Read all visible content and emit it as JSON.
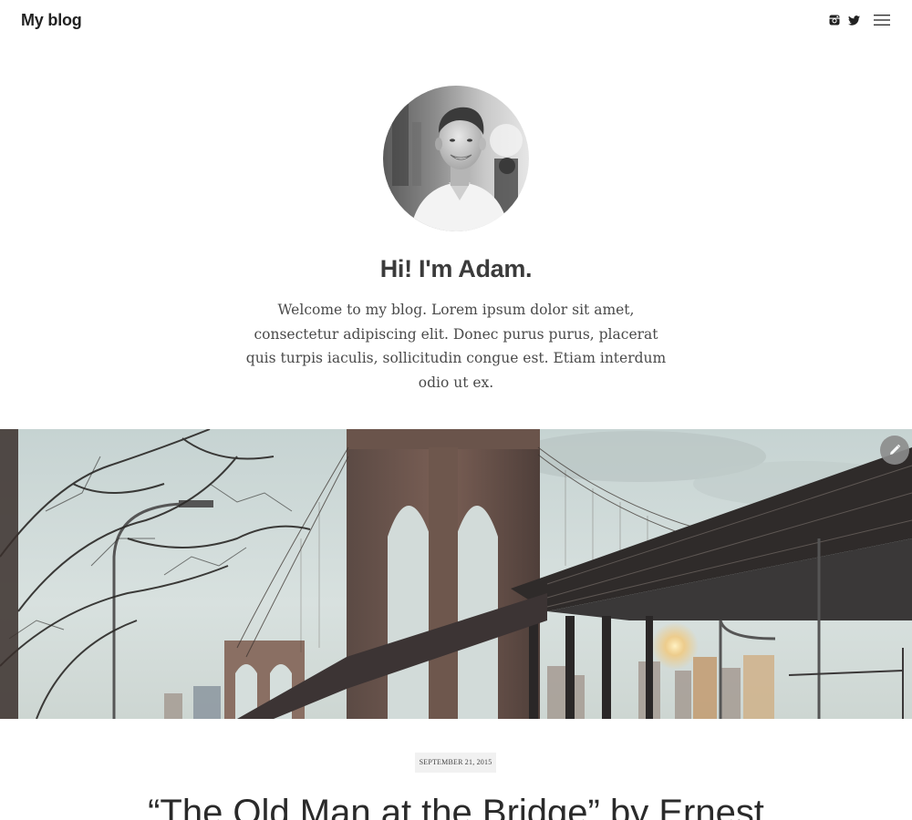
{
  "header": {
    "site_title": "My blog",
    "icons": [
      "instagram-icon",
      "twitter-icon",
      "menu-icon"
    ]
  },
  "intro": {
    "title": "Hi! I'm Adam.",
    "text": "Welcome to my blog. Lorem ipsum dolor sit amet, consectetur adipiscing elit. Donec purus purus, placerat quis turpis iaculis, sollicitudin congue est. Etiam interdum odio ut ex."
  },
  "post": {
    "date": "SEPTEMBER 21, 2015",
    "title": "“The Old Man at the Bridge” by Ernest"
  },
  "colors": {
    "text_dark": "#222222",
    "date_badge_bg": "#f1f1f1",
    "edit_button_bg": "#8c8c8c"
  }
}
